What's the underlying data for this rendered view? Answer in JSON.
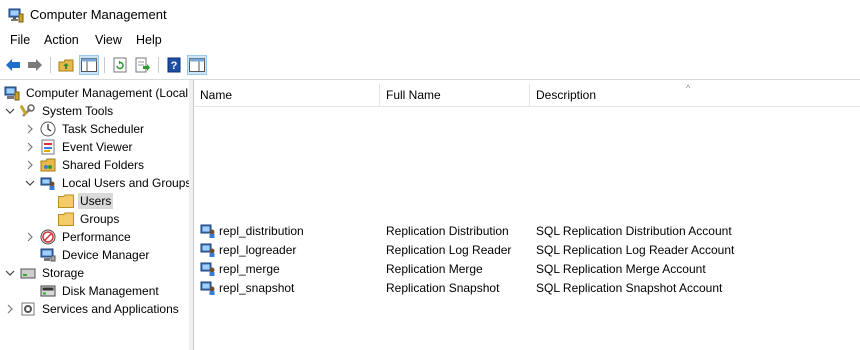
{
  "window": {
    "title": "Computer Management"
  },
  "menu": [
    "File",
    "Action",
    "View",
    "Help"
  ],
  "toolbar": {
    "buttons": [
      "back-icon",
      "forward-icon",
      "up-folder-icon",
      "show-hide-tree-icon",
      "refresh-icon",
      "export-list-icon",
      "help-icon",
      "show-hide-action-pane-icon"
    ]
  },
  "tree": {
    "root": "Computer Management (Local",
    "system_tools": "System Tools",
    "task_scheduler": "Task Scheduler",
    "event_viewer": "Event Viewer",
    "shared_folders": "Shared Folders",
    "local_users_groups": "Local Users and Groups",
    "users": "Users",
    "groups": "Groups",
    "performance": "Performance",
    "device_manager": "Device Manager",
    "storage": "Storage",
    "disk_management": "Disk Management",
    "services_apps": "Services and Applications"
  },
  "list": {
    "columns": [
      "Name",
      "Full Name",
      "Description"
    ],
    "rows": [
      {
        "name": "repl_distribution",
        "full_name": "Replication Distribution",
        "description": "SQL Replication Distribution Account"
      },
      {
        "name": "repl_logreader",
        "full_name": "Replication Log Reader",
        "description": "SQL Replication Log Reader Account"
      },
      {
        "name": "repl_merge",
        "full_name": "Replication Merge",
        "description": "SQL Replication Merge Account"
      },
      {
        "name": "repl_snapshot",
        "full_name": "Replication Snapshot",
        "description": "SQL Replication Snapshot Account"
      }
    ]
  },
  "colors": {
    "selection": "#d9d9d9",
    "toolbar_active": "#cce4f7",
    "back_arrow": "#1e6fc9"
  }
}
